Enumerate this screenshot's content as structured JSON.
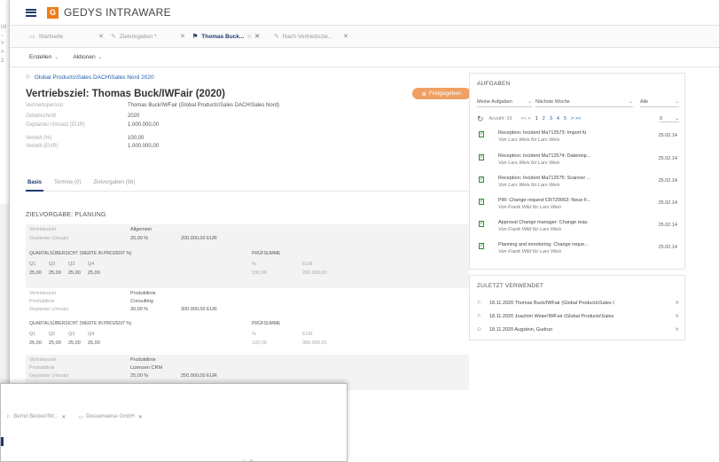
{
  "app": {
    "title": "GEDYS INTRAWARE",
    "logo_glyph": "G"
  },
  "background_window": {
    "fragments": [
      "UI",
      "₌",
      ">",
      ">",
      "2"
    ]
  },
  "tabs": [
    {
      "label": "Startseite",
      "active": false
    },
    {
      "label": "Zielvorgaben *",
      "active": false
    },
    {
      "label": "Thomas Buck...",
      "active": true
    },
    {
      "label": "Nach Vertriebszie...",
      "active": false
    }
  ],
  "toolbar": {
    "create": "Erstellen",
    "actions": "Aktionen"
  },
  "breadcrumb": "Global Products\\Sales DACH\\Sales Nord 2020",
  "page_title": "Vertriebsziel: Thomas Buck/IWFair (2020)",
  "release_button": "Freigegeben",
  "details": [
    {
      "label": "Vertriebsperson",
      "value": "Thomas Buck/IWFair (Global Products\\Sales DACH\\Sales Nord)"
    },
    {
      "label": "Zeitabschnitt",
      "value": "2020"
    },
    {
      "label": "Geplanter Umsatz (EUR)",
      "value": "1.000.000,00"
    },
    {
      "label": "Verteilt (%)",
      "value": "100,00"
    },
    {
      "label": "Verteilt (EUR)",
      "value": "1.000.000,00"
    }
  ],
  "subtabs": [
    "Basis",
    "Termine (0)",
    "Zielvorgaben (56)"
  ],
  "section_title": "ZIELVORGABE: PLANUNG",
  "blocks": [
    {
      "rows": [
        {
          "label": "Vertriebsziel",
          "value": "Allgemein",
          "extra": ""
        },
        {
          "label": "Geplanter Umsatz",
          "value": "20,00 %",
          "extra": "200.000,00 EUR"
        }
      ],
      "quarter_header": "QUARTALSÜBERSICHT (WERTE IN PROZENT %)",
      "sum_header": "PRÜFSUMME",
      "quarters": [
        "Q1",
        "Q2",
        "Q3",
        "Q4"
      ],
      "quarter_values": [
        "25,00",
        "25,00",
        "25,00",
        "25,00"
      ],
      "sum_labels": [
        "%",
        "EUR"
      ],
      "sum_values": [
        "100,00",
        "200.000,00"
      ]
    },
    {
      "rows": [
        {
          "label": "Vertriebsziel",
          "value": "Produktlinie",
          "extra": ""
        },
        {
          "label": "Produktlinie",
          "value": "Consulting",
          "extra": ""
        },
        {
          "label": "Geplanter Umsatz",
          "value": "30,00 %",
          "extra": "300.000,00 EUR"
        }
      ],
      "quarter_header": "QUARTALSÜBERSICHT (WERTE IN PROZENT %)",
      "sum_header": "PRÜFSUMME",
      "quarters": [
        "Q1",
        "Q2",
        "Q3",
        "Q4"
      ],
      "quarter_values": [
        "25,00",
        "25,00",
        "25,00",
        "25,00"
      ],
      "sum_labels": [
        "%",
        "EUR"
      ],
      "sum_values": [
        "100,00",
        "300.000,00"
      ]
    },
    {
      "rows": [
        {
          "label": "Vertriebsziel",
          "value": "Produktlinie",
          "extra": ""
        },
        {
          "label": "Produktlinie",
          "value": "Lizenzen CRM",
          "extra": ""
        },
        {
          "label": "Geplanter Umsatz",
          "value": "25,00 %",
          "extra": "250.000,00 EUR"
        }
      ]
    }
  ],
  "tasks_panel": {
    "title": "AUFGABEN",
    "filter_left": "Meine Aufgaben",
    "filter_mid": "Nächste Woche",
    "filter_right": "Alle",
    "count": "Anzahl: 39",
    "pages": [
      "<< <",
      "1",
      "2",
      "3",
      "4",
      "5",
      "> >>"
    ],
    "page_size": "8",
    "items": [
      {
        "title": "Reception: Incident Ma712573: Import fü",
        "sub": "Von Lars Weis für Lars Weis",
        "date": "25.02.14"
      },
      {
        "title": "Reception: Incident Ma712574: Dateninp...",
        "sub": "Von Lars Weis für Lars Weis",
        "date": "25.02.14"
      },
      {
        "title": "Reception: Incident Ma712575: Scanner ...",
        "sub": "Von Lars Weis für Lars Weis",
        "date": "25.02.14"
      },
      {
        "title": "PIR: Change request CR720063: Neue F...",
        "sub": "Von Frank Wild für Lars Weis",
        "date": "25.02.14"
      },
      {
        "title": "Approval Change manager: Change requ",
        "sub": "Von Frank Wild für Lars Weis",
        "date": "25.02.14"
      },
      {
        "title": "Planning and monitoring: Change reque...",
        "sub": "Von Frank Wild für Lars Weis",
        "date": "25.02.14"
      }
    ]
  },
  "recent_panel": {
    "title": "ZULETZT VERWENDET",
    "items": [
      {
        "text": "18.11.2020  Thomas Buck/IWFair (Global Products\\Sales I",
        "icon": "flag-icon"
      },
      {
        "text": "18.11.2020  Joachim Weier/IWFair (Global Products\\Sales",
        "icon": "flag-icon"
      },
      {
        "text": "18.11.2020  Augstein, Gudrun",
        "icon": "person-icon"
      }
    ]
  },
  "overlay_window": {
    "tabs": [
      {
        "label": "Bernd Becker/IW...",
        "icon": "flag-icon"
      },
      {
        "label": "Dessenweise GmbH",
        "icon": "company-icon"
      }
    ]
  }
}
